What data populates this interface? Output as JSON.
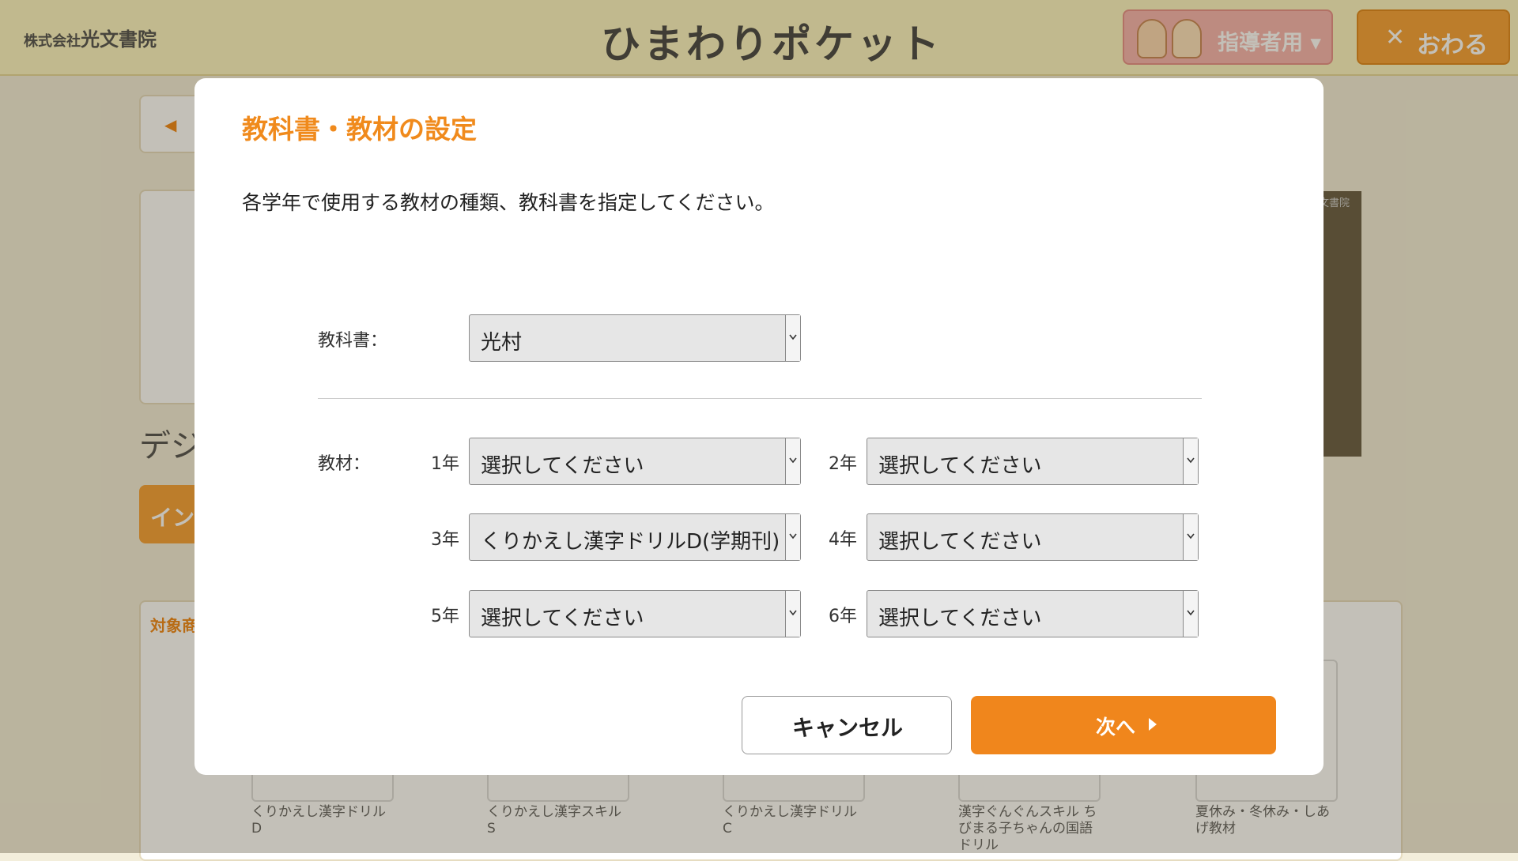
{
  "header": {
    "company_prefix": "株式会社",
    "company_name": "光文書院",
    "logo_text": "ひまわりポケット",
    "teacher_label": "指導者用",
    "close_label": "おわる"
  },
  "background": {
    "heading_partial": "デジ",
    "button_partial": "イン",
    "section_partial": "対象商",
    "promo_text": "文書院",
    "books": [
      {
        "caption": "くりかえし漢字ドリルD"
      },
      {
        "caption": "くりかえし漢字スキルS"
      },
      {
        "caption": "くりかえし漢字ドリルC"
      },
      {
        "caption": "漢字ぐんぐんスキル ちびまる子ちゃんの国語ドリル"
      },
      {
        "caption": "夏休み・冬休み・しあげ教材"
      }
    ]
  },
  "modal": {
    "title": "教科書・教材の設定",
    "description": "各学年で使用する教材の種類、教科書を指定してください。",
    "textbook_label": "教科書：",
    "textbook_value": "光村",
    "material_label": "教材：",
    "grades": [
      {
        "label": "1年",
        "value": "選択してください"
      },
      {
        "label": "2年",
        "value": "選択してください"
      },
      {
        "label": "3年",
        "value": "くりかえし漢字ドリルD(学期刊)"
      },
      {
        "label": "4年",
        "value": "選択してください"
      },
      {
        "label": "5年",
        "value": "選択してください"
      },
      {
        "label": "6年",
        "value": "選択してください"
      }
    ],
    "cancel_label": "キャンセル",
    "next_label": "次へ"
  },
  "colors": {
    "accent_orange": "#f08a1c",
    "title_orange": "#f08a1c",
    "header_bg": "#fdf6c5"
  }
}
